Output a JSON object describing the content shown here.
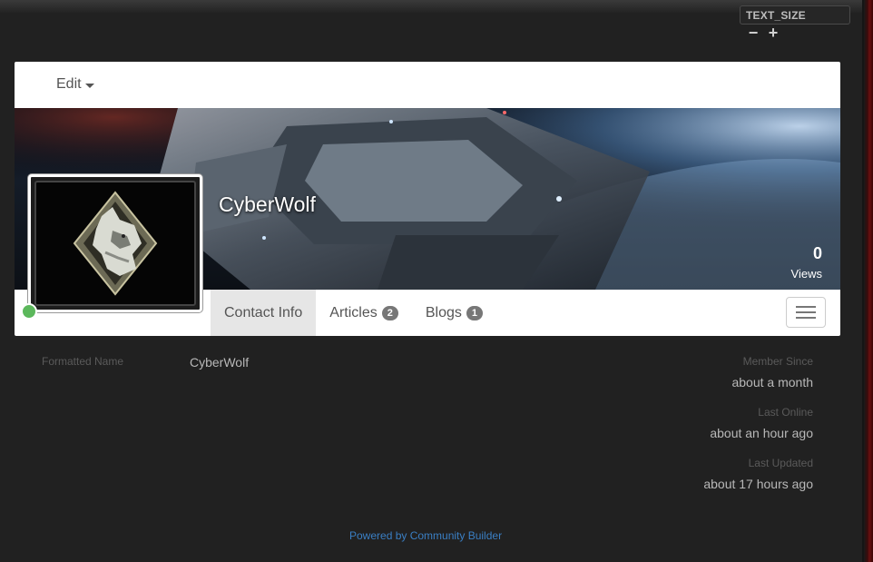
{
  "text_size": {
    "label": "TEXT_SIZE",
    "decrease": "−",
    "increase": "+"
  },
  "profile": {
    "edit_label": "Edit",
    "username": "CyberWolf",
    "views_count": "0",
    "views_label": "Views",
    "online_status_color": "#5cb85c"
  },
  "tabs": [
    {
      "label": "Contact Info",
      "badge": ""
    },
    {
      "label": "Articles",
      "badge": "2"
    },
    {
      "label": "Blogs",
      "badge": "1"
    }
  ],
  "contact": {
    "formatted_name_label": "Formatted Name",
    "formatted_name_value": "CyberWolf"
  },
  "stats": {
    "member_since_label": "Member Since",
    "member_since_value": "about a month",
    "last_online_label": "Last Online",
    "last_online_value": "about an hour ago",
    "last_updated_label": "Last Updated",
    "last_updated_value": "about 17 hours ago"
  },
  "footer": {
    "powered_by": "Powered by Community Builder"
  },
  "colors": {
    "page_bg": "#212121",
    "card_bg": "#ffffff",
    "link": "#3a7fc4",
    "badge": "#777777"
  }
}
